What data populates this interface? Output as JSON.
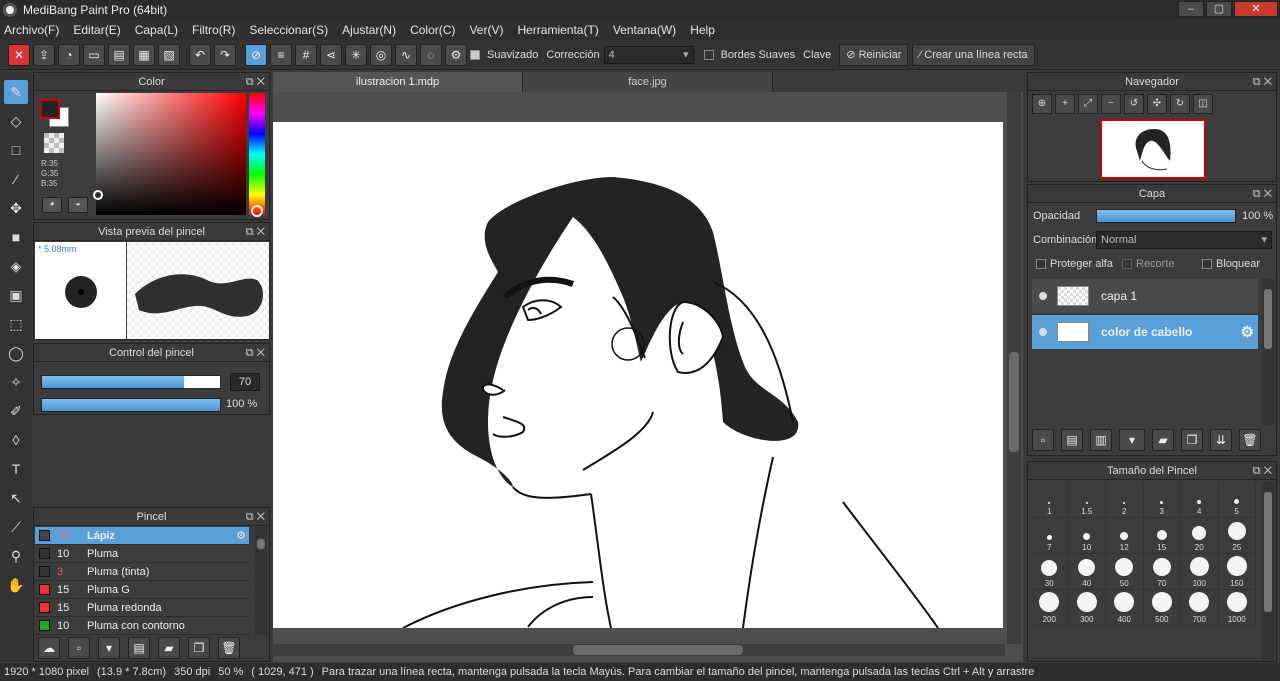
{
  "window": {
    "title": "MediBang Paint Pro (64bit)",
    "min": "–",
    "max": "▢",
    "close": "✕"
  },
  "menu": [
    "Archivo(F)",
    "Editar(E)",
    "Capa(L)",
    "Filtro(R)",
    "Seleccionar(S)",
    "Ajustar(N)",
    "Color(C)",
    "Ver(V)",
    "Herramienta(T)",
    "Ventana(W)",
    "Help"
  ],
  "toolbar": {
    "smoothing_label": "Suavizado",
    "correction_label": "Corrección",
    "correction_value": "4",
    "soft_edges_label": "Bordes Suaves",
    "key_label": "Clave",
    "reset_label": "Reiniciar",
    "straight_line_label": "Crear una línea recta"
  },
  "panels": {
    "color": {
      "title": "Color",
      "r": "R:35",
      "g": "G:35",
      "b": "B:35",
      "fg": "#232323"
    },
    "brush_preview": {
      "title": "Vista previa del pincel",
      "size": "* 5.08mm"
    },
    "brush_control": {
      "title": "Control del pincel",
      "size_value": "70",
      "opacity_value": "100 %",
      "size_fraction": 0.8,
      "opacity_fraction": 1.0
    },
    "brush": {
      "title": "Pincel",
      "items": [
        {
          "size": "70",
          "name": "Lápiz",
          "color": "#444444",
          "size_color": "#ff6666"
        },
        {
          "size": "10",
          "name": "Pluma",
          "color": "#333333",
          "size_color": "#eeeeee"
        },
        {
          "size": "3",
          "name": "Pluma (tinta)",
          "color": "#333333",
          "size_color": "#ff5555"
        },
        {
          "size": "15",
          "name": "Pluma G",
          "color": "#ee3333",
          "size_color": "#eeeeee"
        },
        {
          "size": "15",
          "name": "Pluma redonda",
          "color": "#ee3333",
          "size_color": "#eeeeee"
        },
        {
          "size": "10",
          "name": "Pluma con contorno",
          "color": "#22aa22",
          "size_color": "#eeeeee"
        }
      ]
    },
    "navigator": {
      "title": "Navegador"
    },
    "layer": {
      "title": "Capa",
      "opacity_label": "Opacidad",
      "opacity_value": "100 %",
      "blend_label": "Combinación",
      "blend_value": "Normal",
      "protect_alpha": "Proteger alfa",
      "clip": "Recorte",
      "lock": "Bloquear",
      "layers": [
        {
          "name": "capa 1"
        },
        {
          "name": "color de cabello"
        }
      ]
    },
    "brush_size": {
      "title": "Tamaño del Pincel",
      "sizes": [
        "1",
        "1.5",
        "2",
        "3",
        "4",
        "5",
        "7",
        "10",
        "12",
        "15",
        "20",
        "25",
        "30",
        "40",
        "50",
        "70",
        "100",
        "150",
        "200",
        "300",
        "400",
        "500",
        "700",
        "1000"
      ]
    }
  },
  "tabs": [
    {
      "label": "ilustracion 1.mdp"
    },
    {
      "label": "face.jpg"
    }
  ],
  "status": {
    "pixels": "1920 * 1080 pixel",
    "cm": "(13.9 * 7.8cm)",
    "dpi": "350 dpi",
    "zoom": "50 %",
    "coords": "( 1029, 471 )",
    "hint": "Para trazar una línea recta, mantenga pulsada la tecla Mayús. Para cambiar el tamaño del pincel, mantenga pulsada las teclas Ctrl + Alt y arrastre"
  }
}
